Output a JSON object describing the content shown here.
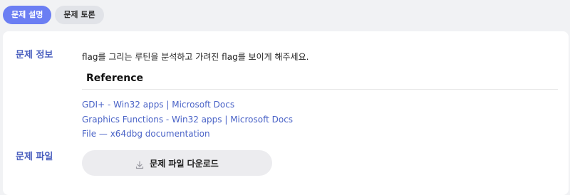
{
  "tabs": [
    {
      "label": "문제 설명",
      "active": true
    },
    {
      "label": "문제 토론",
      "active": false
    }
  ],
  "info": {
    "label": "문제 정보",
    "description": "flag를 그리는 루틴을 분석하고 가려진 flag를 보이게 해주세요.",
    "reference_heading": "Reference",
    "links": [
      "GDI+ - Win32 apps | Microsoft Docs",
      "Graphics Functions - Win32 apps | Microsoft Docs",
      "File — x64dbg documentation"
    ]
  },
  "file": {
    "label": "문제 파일",
    "download_label": "문제 파일 다운로드",
    "icon": "download-icon"
  },
  "colors": {
    "accent": "#6b7ef3",
    "link": "#4a63c7",
    "section_label": "#4a5fbf"
  }
}
